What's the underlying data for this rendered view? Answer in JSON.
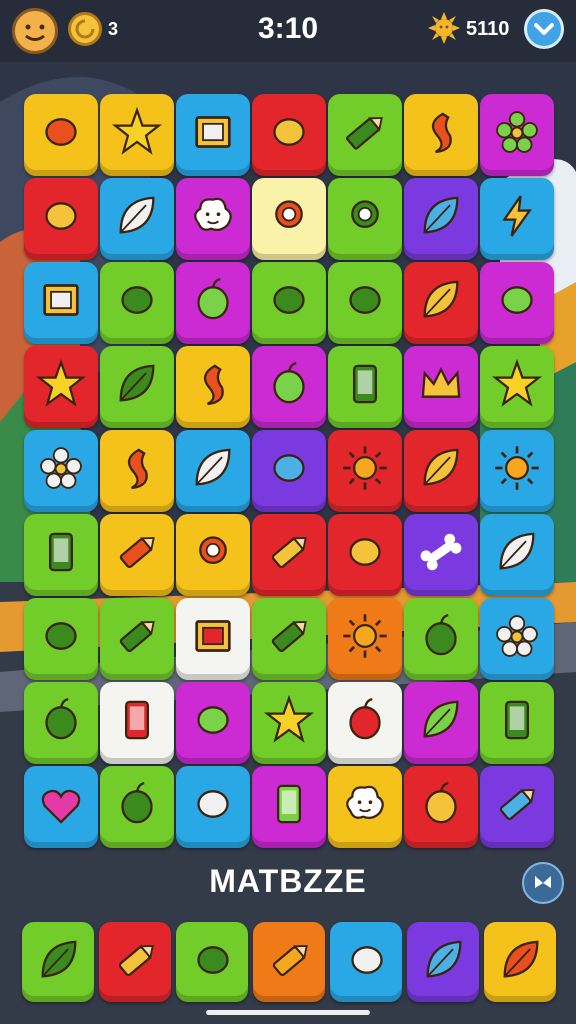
{
  "header": {
    "coins": "3",
    "timer": "3:10",
    "score": "5110"
  },
  "brand": "MATBZZE",
  "colors": {
    "yellow": "#f4c21a",
    "red": "#e2262b",
    "green": "#72cc2a",
    "blue": "#2aa8e6",
    "magenta": "#cc2ad2",
    "purple": "#7a3ae0",
    "orange": "#f07a18",
    "white": "#f4f4f0",
    "cream": "#faf2a8"
  },
  "board": {
    "rows": [
      [
        "yellow:bird-icon",
        "yellow:star-icon",
        "blue:frame-icon",
        "red:melon-icon",
        "green:pencil-icon",
        "yellow:swirl-icon",
        "magenta:flower-icon"
      ],
      [
        "red:berries-icon",
        "blue:feather-icon",
        "magenta:cloud-face-icon",
        "cream:target-icon",
        "green:gear-icon",
        "purple:leaf-icon",
        "blue:lightning-icon"
      ],
      [
        "blue:frame-icon",
        "green:carrot-icon",
        "magenta:apple-icon",
        "green:diamond-sign-icon",
        "green:eggplant-icon",
        "red:leaf-icon",
        "magenta:cherry-icon"
      ],
      [
        "red:star-icon",
        "green:leaf-icon",
        "yellow:swirl-icon",
        "magenta:peach-icon",
        "green:phone-icon",
        "magenta:crown-icon",
        "green:star-icon"
      ],
      [
        "blue:flower-icon",
        "yellow:drop-icon",
        "blue:leaf-icon",
        "purple:tulip-icon",
        "red:sun-icon",
        "red:maple-leaf-icon",
        "blue:sun-icon"
      ],
      [
        "green:tablet-icon",
        "yellow:crayon-icon",
        "yellow:medal-icon",
        "red:crayon-icon",
        "red:bottle-icon",
        "purple:bone-icon",
        "blue:leaf-icon"
      ],
      [
        "green:pot-icon",
        "green:crayon-icon",
        "white:square-icon",
        "green:crayon-icon",
        "orange:sun-icon",
        "green:egg-icon",
        "blue:flower-icon"
      ],
      [
        "green:plum-icon",
        "white:phone-icon",
        "magenta:banana-icon",
        "green:star-icon",
        "white:ball-icon",
        "magenta:leaf-icon",
        "green:battery-icon"
      ],
      [
        "blue:heart-icon",
        "green:lemon-icon",
        "blue:football-icon",
        "magenta:phone-icon",
        "yellow:cloud-face-icon",
        "red:apple-icon",
        "purple:crayon-icon"
      ]
    ]
  },
  "tray": [
    "green:feather-icon",
    "red:crayon-icon",
    "green:carrot-icon",
    "orange:crayon-icon",
    "blue:flag-icon",
    "purple:leaf-icon",
    "yellow:leaf-icon"
  ]
}
